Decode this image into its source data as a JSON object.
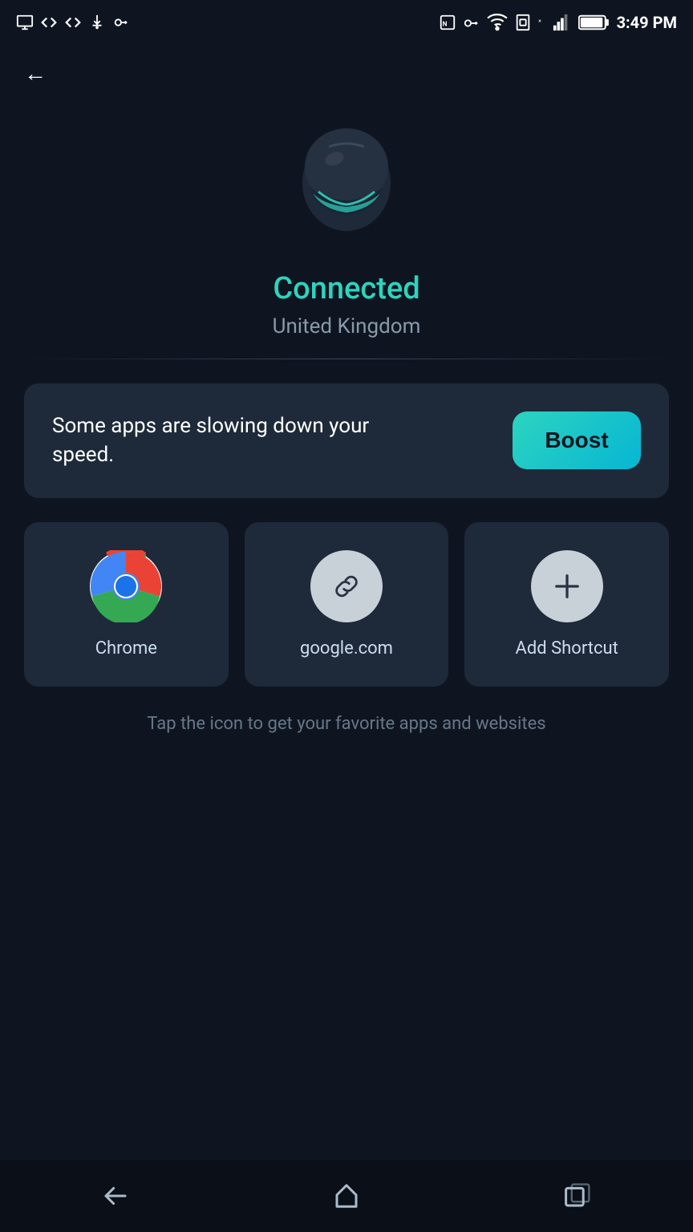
{
  "statusBar": {
    "time": "3:49 PM",
    "icons": [
      "screenshot",
      "code1",
      "code2",
      "usb",
      "key",
      "nfc",
      "vpnkey",
      "wifi",
      "sim",
      "signal",
      "battery"
    ]
  },
  "header": {
    "backLabel": "←"
  },
  "hero": {
    "statusLabel": "Connected",
    "locationLabel": "United Kingdom"
  },
  "boostCard": {
    "message": "Some apps are slowing down your speed.",
    "buttonLabel": "Boost"
  },
  "shortcuts": [
    {
      "id": "chrome",
      "label": "Chrome",
      "iconType": "chrome"
    },
    {
      "id": "google",
      "label": "google.com",
      "iconType": "link"
    },
    {
      "id": "add",
      "label": "Add Shortcut",
      "iconType": "plus"
    }
  ],
  "hint": {
    "text": "Tap the icon to get your favorite apps and websites"
  },
  "navBar": {
    "backIcon": "↩",
    "homeIcon": "⌂",
    "recentsIcon": "⧉"
  }
}
